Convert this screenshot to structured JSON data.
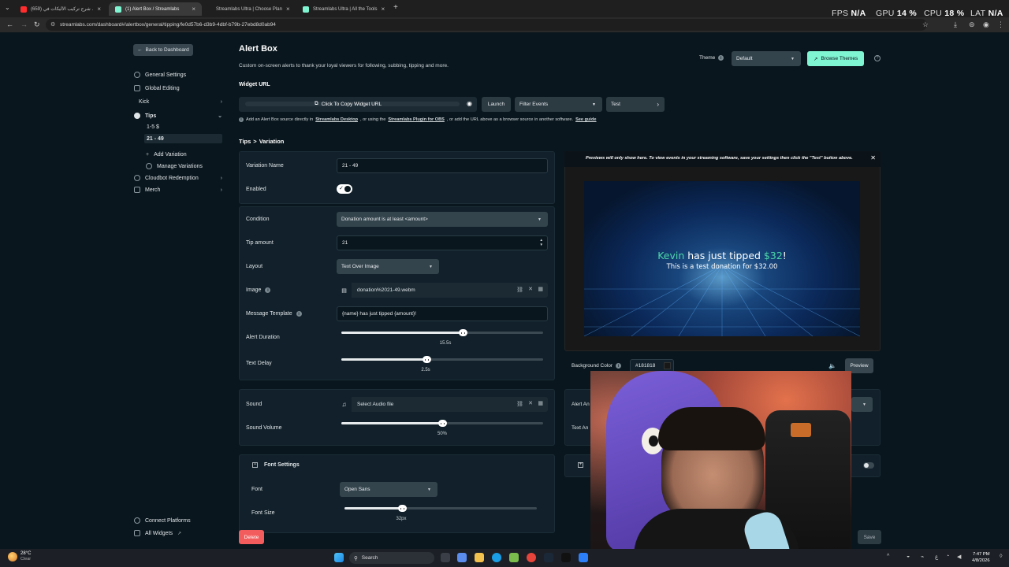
{
  "browser": {
    "tabs": [
      {
        "title": "(659) شرح تركيب الأليكات في ...",
        "color": "#ff2d2d"
      },
      {
        "title": "(1) Alert Box / Streamlabs",
        "color": "#80f5d2"
      },
      {
        "title": "Streamlabs Ultra | Choose Plan",
        "color": "#80f5d2"
      },
      {
        "title": "Streamlabs Ultra | All the Tools",
        "color": "#80f5d2"
      }
    ],
    "new_tab": "+",
    "url": "streamlabs.com/dashboard#/alertbox/general/tipping/fe0d57b6-d3b9-4dbf-b79b-27ebd8d0ab94"
  },
  "hud": {
    "fps_label": "FPS",
    "fps_value": "N/A",
    "gpu_label": "GPU",
    "gpu_value": "14 %",
    "cpu_label": "CPU",
    "cpu_value": "18 %",
    "lat_label": "LAT",
    "lat_value": "N/A"
  },
  "sidebar": {
    "back": "Back to Dashboard",
    "general_settings": "General Settings",
    "global_editing": "Global Editing",
    "kick": "Kick",
    "tips": "Tips",
    "tip_variations": [
      "1-5 $",
      "21 - 49"
    ],
    "add_variation": "Add Variation",
    "manage_variations": "Manage Variations",
    "cloudbot": "Cloudbot Redemption",
    "merch": "Merch",
    "connect_platforms": "Connect Platforms",
    "all_widgets": "All Widgets"
  },
  "header": {
    "title": "Alert Box",
    "subtitle": "Custom on-screen alerts to thank your loyal viewers for following, subbing, tipping and more.",
    "theme_label": "Theme",
    "theme_value": "Default",
    "browse_themes": "Browse Themes",
    "widget_url_label": "Widget URL",
    "copy_url": "Click To Copy Widget URL",
    "launch": "Launch",
    "filter_events": "Filter Events",
    "test": "Test",
    "hint_prefix": "Add an Alert Box source directly in",
    "hint_link1": "Streamlabs Desktop",
    "hint_mid": ", or using the",
    "hint_link2": "Streamlabs Plugin for OBS",
    "hint_suffix": ", or add the URL above as a browser source in another software.",
    "hint_link3": "See guide"
  },
  "breadcrumb": {
    "parent": "Tips",
    "sep": ">",
    "current": "Variation"
  },
  "form": {
    "variation_name_label": "Variation Name",
    "variation_name_value": "21 - 49",
    "enabled_label": "Enabled",
    "enabled": true,
    "condition_label": "Condition",
    "condition_value": "Donation amount is at least <amount>",
    "tip_amount_label": "Tip amount",
    "tip_amount_value": "21",
    "layout_label": "Layout",
    "layout_value": "Text Over Image",
    "image_label": "Image",
    "image_value": "donation%2021-49.webm",
    "message_template_label": "Message Template",
    "message_template_value": "{name} has just tipped {amount}!",
    "alert_duration_label": "Alert Duration",
    "alert_duration_value": "15.5s",
    "alert_duration_level": 0.6,
    "text_delay_label": "Text Delay",
    "text_delay_value": "2.5s",
    "text_delay_level": 0.42,
    "sound_label": "Sound",
    "sound_value": "Select Audio file",
    "sound_volume_label": "Sound Volume",
    "sound_volume_value": "50%",
    "sound_volume_level": 0.5,
    "font_settings_label": "Font Settings",
    "font_label": "Font",
    "font_value": "Open Sans",
    "font_size_label": "Font Size",
    "font_size_value": "32px",
    "font_size_level": 0.3
  },
  "preview": {
    "notice": "Previews will only show here. To view events in your streaming software, save your settings then click the \"Test\" button above.",
    "name": "Kevin",
    "mid": " has just tipped ",
    "amount": "$32",
    "end": "!",
    "message": "This is a test donation for $32.00",
    "bg_color_label": "Background Color",
    "bg_color_value": "#181818",
    "preview_btn": "Preview",
    "alert_an_label": "Alert An",
    "text_an_label": "Text An"
  },
  "footer": {
    "delete": "Delete",
    "save": "Save"
  },
  "taskbar": {
    "weather_temp": "28°C",
    "weather_text": "Clear",
    "search": "Search",
    "time": "7:47 PM",
    "date": "4/8/2026"
  },
  "colors": {
    "accent": "#80f5d2",
    "danger": "#f25c5c",
    "name_color": "#4cd7a8"
  }
}
